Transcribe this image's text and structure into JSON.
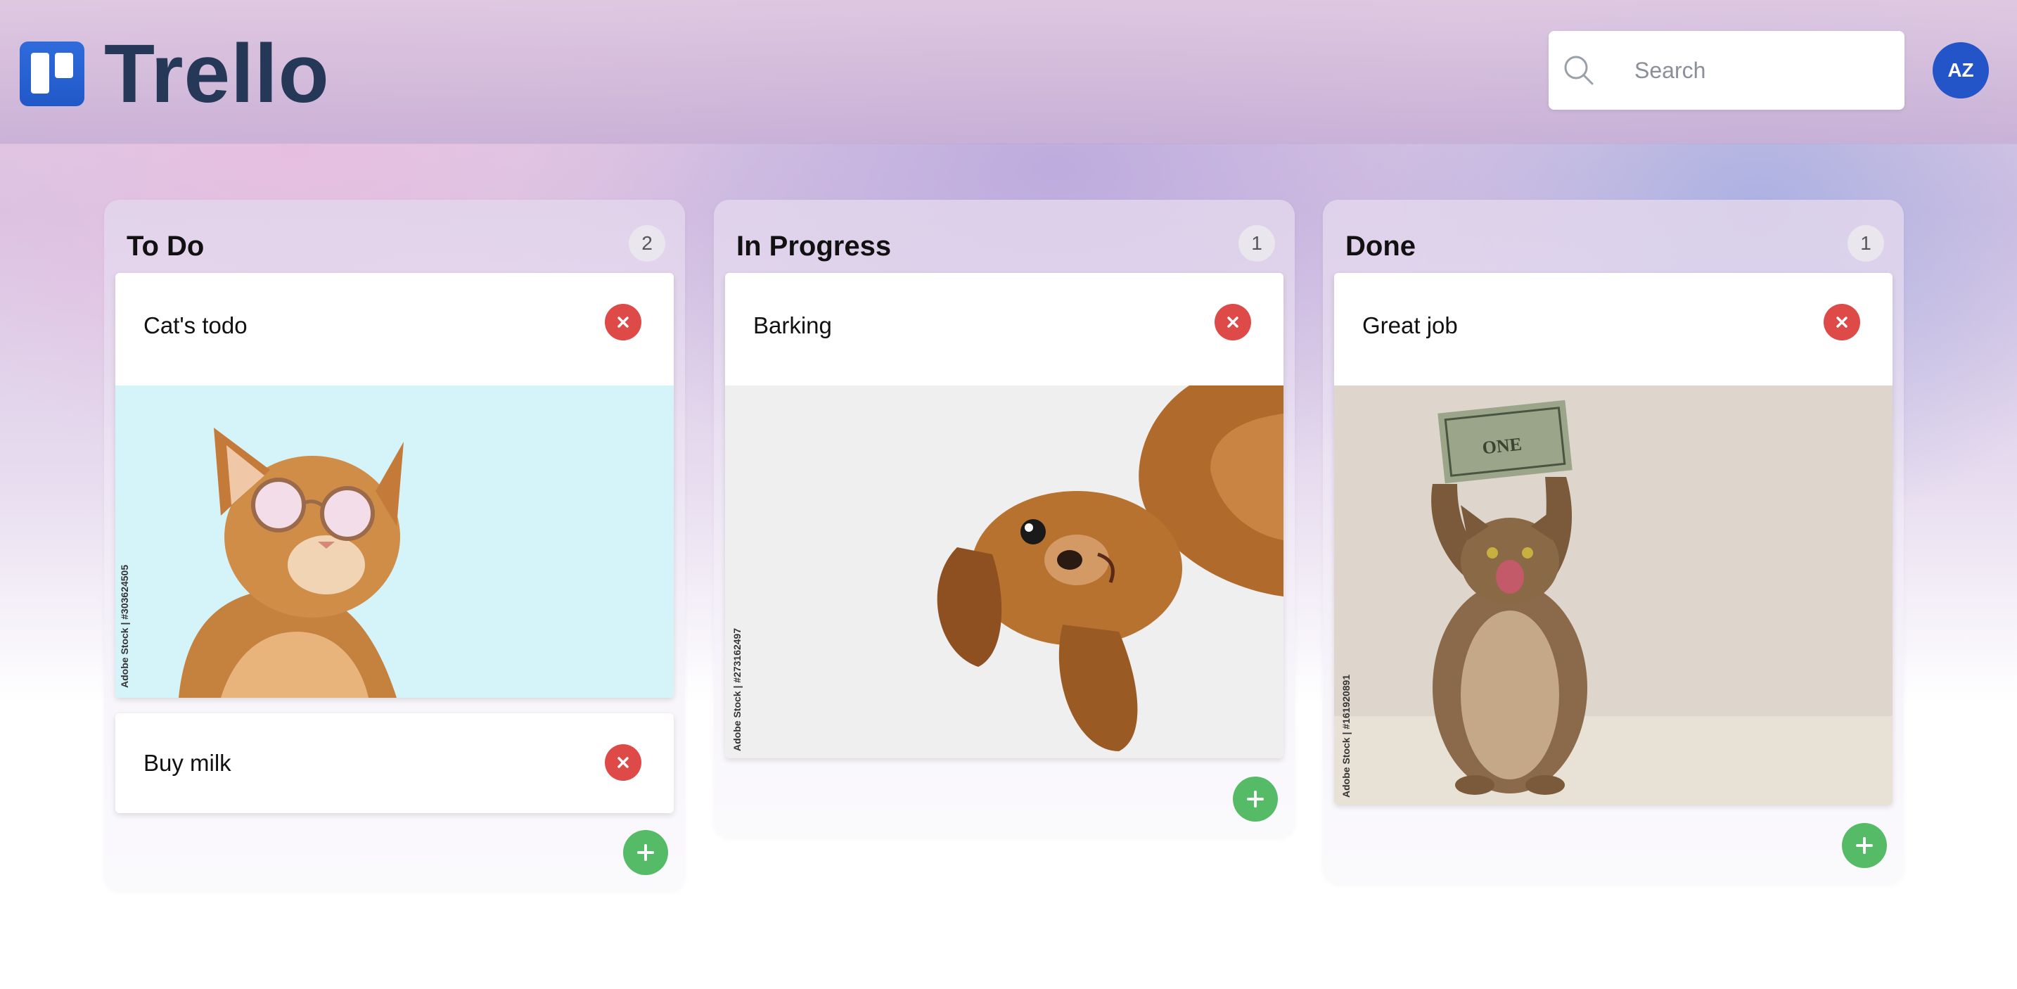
{
  "app": {
    "logo_text": "Trello"
  },
  "header": {
    "search_placeholder": "Search",
    "avatar_initials": "AZ"
  },
  "columns": [
    {
      "title": "To Do",
      "count": "2",
      "cards": [
        {
          "title": "Cat's todo",
          "image_watermark": "Adobe Stock | #303624505"
        },
        {
          "title": "Buy milk"
        }
      ]
    },
    {
      "title": "In Progress",
      "count": "1",
      "cards": [
        {
          "title": "Barking",
          "image_watermark": "Adobe Stock | #273162497"
        }
      ]
    },
    {
      "title": "Done",
      "count": "1",
      "cards": [
        {
          "title": "Great job",
          "image_watermark": "Adobe Stock | #161920891"
        }
      ]
    }
  ],
  "colors": {
    "brand": "#2f6bdc",
    "logo_text": "#253858",
    "delete": "#dd4a48",
    "add": "#55bb66",
    "avatar": "#2355c8"
  },
  "icons": {
    "search": "search-icon",
    "delete": "close-icon",
    "add": "plus-icon"
  }
}
